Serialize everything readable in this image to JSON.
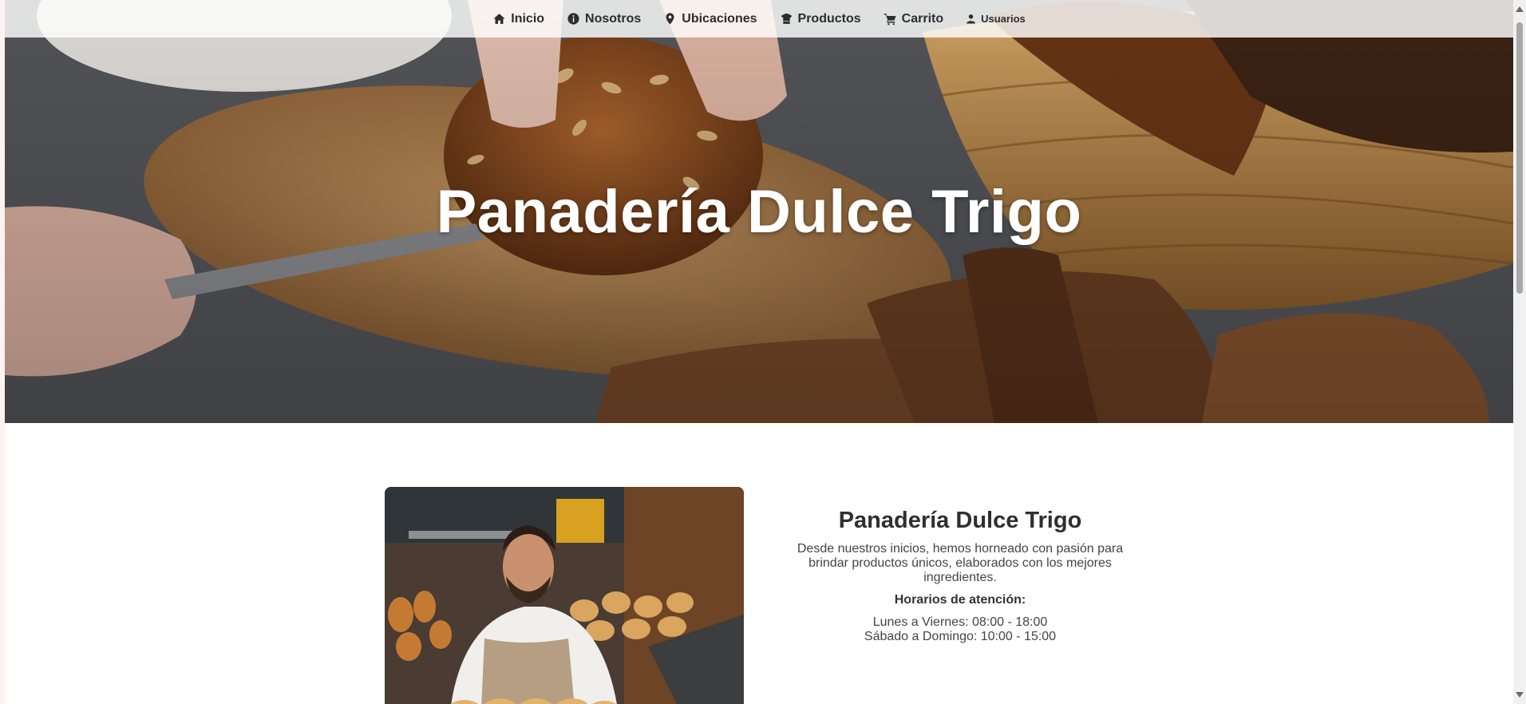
{
  "nav": {
    "items": [
      {
        "label": "Inicio",
        "icon": "home-icon"
      },
      {
        "label": "Nosotros",
        "icon": "info-icon"
      },
      {
        "label": "Ubicaciones",
        "icon": "map-pin-icon"
      },
      {
        "label": "Productos",
        "icon": "chef-hat-icon"
      },
      {
        "label": "Carrito",
        "icon": "cart-icon"
      },
      {
        "label": "Usuarios",
        "icon": "user-icon"
      }
    ]
  },
  "hero": {
    "title": "Panadería Dulce Trigo"
  },
  "about": {
    "title": "Panadería Dulce Trigo",
    "description": "Desde nuestros inicios, hemos horneado con pasión para brindar productos únicos, elaborados con los mejores ingredientes.",
    "hours_title": "Horarios de atención:",
    "hours": [
      "Lunes a Viernes: 08:00 - 18:00",
      "Sábado a Domingo: 10:00 - 15:00"
    ]
  },
  "colors": {
    "nav_background": "#ffffff",
    "text_dark": "#2d2d2d",
    "hero_text": "#ffffff"
  }
}
